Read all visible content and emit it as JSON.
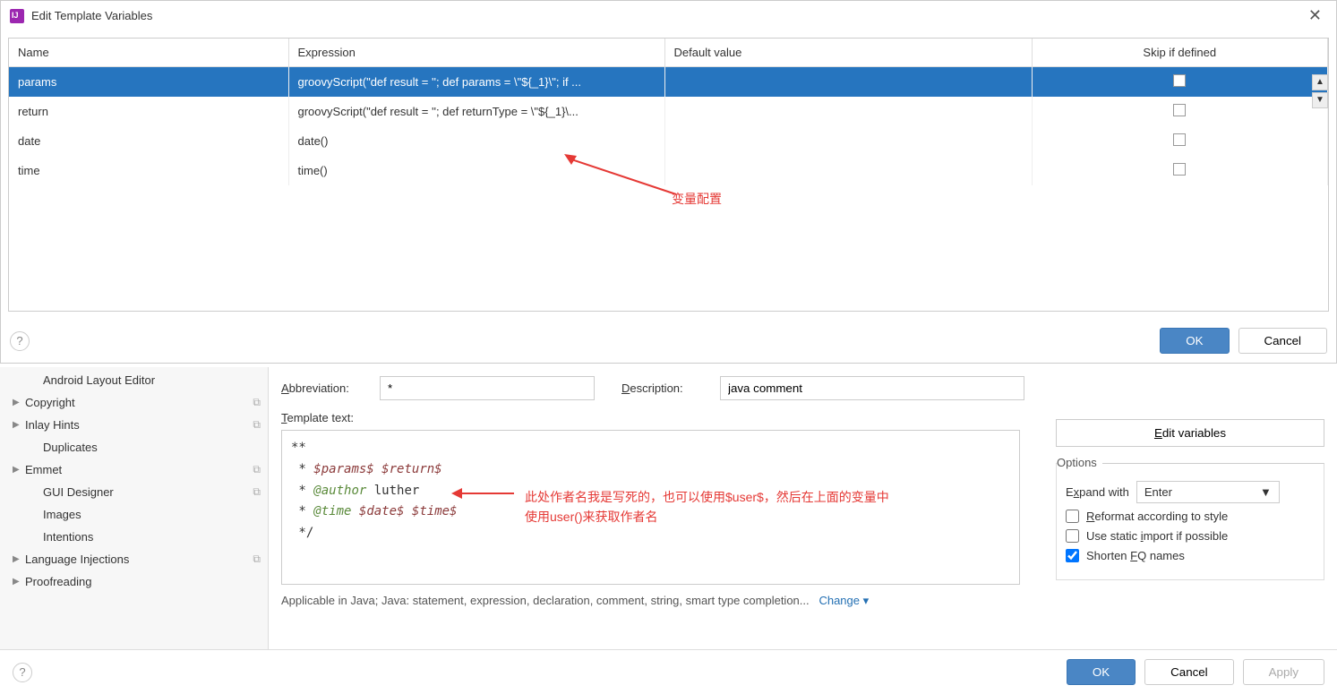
{
  "dialog": {
    "title": "Edit Template Variables",
    "columns": {
      "name": "Name",
      "expression": "Expression",
      "default": "Default value",
      "skip": "Skip if defined"
    },
    "rows": [
      {
        "name": "params",
        "expression": "groovyScript(\"def result = ''; def params = \\\"${_1}\\\"; if ...",
        "default": "",
        "skip": false,
        "selected": true
      },
      {
        "name": "return",
        "expression": "groovyScript(\"def result = ''; def returnType = \\\"${_1}\\...",
        "default": "",
        "skip": false,
        "selected": false
      },
      {
        "name": "date",
        "expression": "date()",
        "default": "",
        "skip": false,
        "selected": false
      },
      {
        "name": "time",
        "expression": "time()",
        "default": "",
        "skip": false,
        "selected": false
      }
    ],
    "ok": "OK",
    "cancel": "Cancel"
  },
  "annotations": {
    "a1": "变量配置",
    "a2_line1": "此处作者名我是写死的，也可以使用$user$，然后在上面的变量中",
    "a2_line2": "使用user()来获取作者名"
  },
  "sidebar": {
    "items": [
      {
        "label": "Android Layout Editor",
        "arrow": false,
        "copy": false,
        "indent": true
      },
      {
        "label": "Copyright",
        "arrow": true,
        "copy": true,
        "indent": false
      },
      {
        "label": "Inlay Hints",
        "arrow": true,
        "copy": true,
        "indent": false
      },
      {
        "label": "Duplicates",
        "arrow": false,
        "copy": false,
        "indent": true
      },
      {
        "label": "Emmet",
        "arrow": true,
        "copy": true,
        "indent": false
      },
      {
        "label": "GUI Designer",
        "arrow": false,
        "copy": true,
        "indent": true
      },
      {
        "label": "Images",
        "arrow": false,
        "copy": false,
        "indent": true
      },
      {
        "label": "Intentions",
        "arrow": false,
        "copy": false,
        "indent": true
      },
      {
        "label": "Language Injections",
        "arrow": true,
        "copy": true,
        "indent": false
      },
      {
        "label": "Proofreading",
        "arrow": true,
        "copy": false,
        "indent": false
      }
    ]
  },
  "form": {
    "abbrev_label": "Abbreviation:",
    "abbrev_value": "*",
    "desc_label": "Description:",
    "desc_value": "java comment",
    "template_label": "Template text:",
    "edit_vars": "Edit variables",
    "options_label": "Options",
    "expand_label": "Expand with",
    "expand_value": "Enter",
    "reformat": "Reformat according to style",
    "static_import": "Use static import if possible",
    "shorten_fq": "Shorten FQ names",
    "applicable": "Applicable in Java; Java: statement, expression, declaration, comment, string, smart type completion...",
    "change": "Change"
  },
  "template_text": {
    "l1": "**",
    "l2a": " * ",
    "l2b": "$params$",
    "l2c": " ",
    "l2d": "$return$",
    "l3a": " * ",
    "l3b": "@author",
    "l3c": " luther",
    "l4a": " * ",
    "l4b": "@time",
    "l4c": " ",
    "l4d": "$date$",
    "l4e": " ",
    "l4f": "$time$",
    "l5": " */"
  },
  "bottom": {
    "ok": "OK",
    "cancel": "Cancel",
    "apply": "Apply"
  }
}
